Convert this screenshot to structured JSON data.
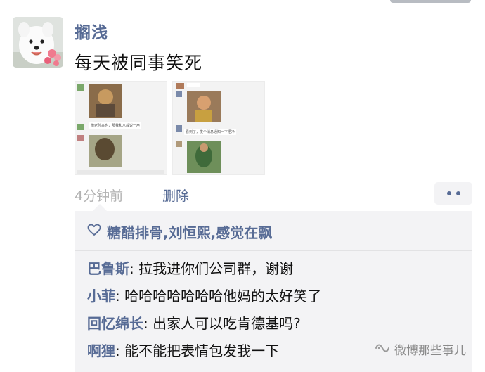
{
  "post": {
    "username": "搁浅",
    "text": "每天被同事笑死",
    "time": "4分钟前",
    "delete_label": "删除"
  },
  "thumbnails": [
    {
      "caption": "俺老孙来也，那我和八戒说一声"
    },
    {
      "caption": "看到了，发个消息通知一下悟净"
    }
  ],
  "likes": {
    "icon": "heart-outline-icon",
    "names": "糖醋排骨,刘恒熙,感觉在飘"
  },
  "comments": [
    {
      "name": "巴鲁斯",
      "text": ": 拉我进你们公司群，谢谢"
    },
    {
      "name": "小菲",
      "text": ": 哈哈哈哈哈哈哈他妈的太好笑了"
    },
    {
      "name": "回忆绵长",
      "text": ": 出家人可以吃肯德基吗?"
    },
    {
      "name": "啊狸",
      "text": ": 能不能把表情包发我一下"
    }
  ],
  "watermark": {
    "icon": "wechat-channel-icon",
    "text": "微博那些事儿"
  },
  "colors": {
    "link": "#576b95",
    "comment_bg": "#f3f3f5",
    "meta_gray": "#b2b2b2"
  }
}
